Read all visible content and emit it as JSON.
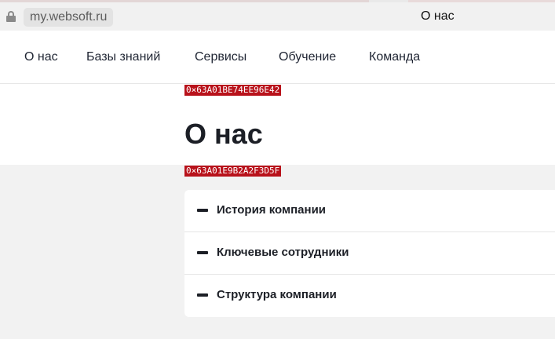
{
  "browser": {
    "url": "my.websoft.ru",
    "tab_title": "О нас",
    "lock_icon": "lock-icon"
  },
  "nav": {
    "items": [
      {
        "label": "О нас"
      },
      {
        "label": "Базы знаний"
      },
      {
        "label": "Сервисы"
      },
      {
        "label": "Обучение"
      },
      {
        "label": "Команда"
      }
    ]
  },
  "page": {
    "title": "О нас",
    "debug_tags": [
      "0×63A01BE74EE96E42",
      "0×63A01E9B2A2F3D5F"
    ]
  },
  "accordion": {
    "items": [
      {
        "label": "История компании",
        "icon": "minus-icon"
      },
      {
        "label": "Ключевые сотрудники",
        "icon": "minus-icon"
      },
      {
        "label": "Структура компании",
        "icon": "minus-icon"
      }
    ]
  },
  "colors": {
    "background": "#f2f2f2",
    "surface": "#ffffff",
    "text": "#1c1f26",
    "debug_tag": "#b8121b"
  }
}
